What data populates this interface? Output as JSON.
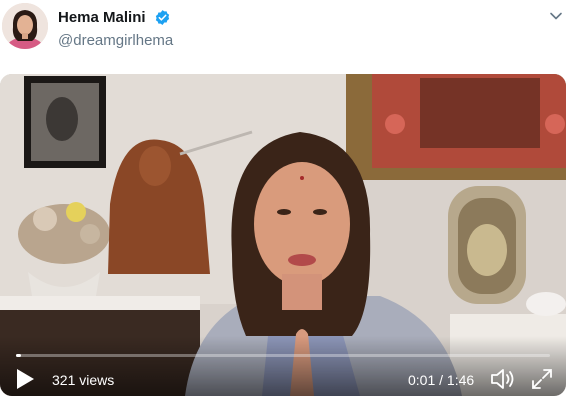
{
  "user": {
    "display_name": "Hema Malini",
    "handle": "@dreamgirlhema",
    "verified": true
  },
  "video": {
    "views": "321 views",
    "current_time": "0:01",
    "duration": "1:46",
    "time_display": "0:01 / 1:46",
    "progress_fraction": 0.01
  },
  "icons": {
    "verified": "verified-badge-icon",
    "caret": "chevron-down-icon",
    "play": "play-icon",
    "volume": "volume-icon",
    "fullscreen": "fullscreen-icon"
  },
  "colors": {
    "verified_blue": "#1da1f2",
    "handle_gray": "#657786"
  }
}
